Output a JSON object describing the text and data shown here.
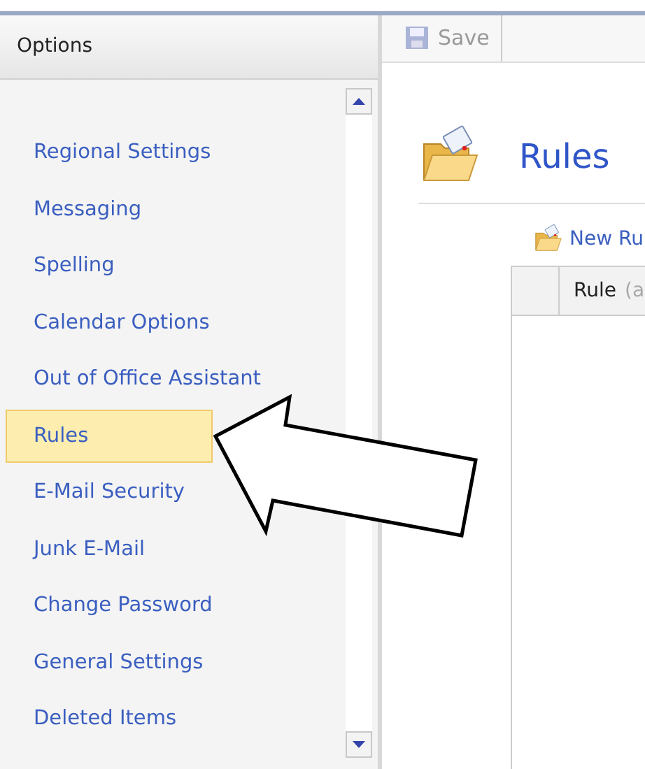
{
  "sidebar": {
    "title": "Options",
    "items": [
      {
        "label": "Regional Settings",
        "selected": false
      },
      {
        "label": "Messaging",
        "selected": false
      },
      {
        "label": "Spelling",
        "selected": false
      },
      {
        "label": "Calendar Options",
        "selected": false
      },
      {
        "label": "Out of Office Assistant",
        "selected": false
      },
      {
        "label": "Rules",
        "selected": true
      },
      {
        "label": "E-Mail Security",
        "selected": false
      },
      {
        "label": "Junk E-Mail",
        "selected": false
      },
      {
        "label": "Change Password",
        "selected": false
      },
      {
        "label": "General Settings",
        "selected": false
      },
      {
        "label": "Deleted Items",
        "selected": false
      }
    ]
  },
  "toolbar": {
    "save": {
      "label": "Save",
      "disabled": true
    }
  },
  "page": {
    "title": "Rules",
    "new_link": "New Ru",
    "table": {
      "columns": [
        {
          "label": "Rule",
          "hint": "(a"
        }
      ]
    }
  }
}
